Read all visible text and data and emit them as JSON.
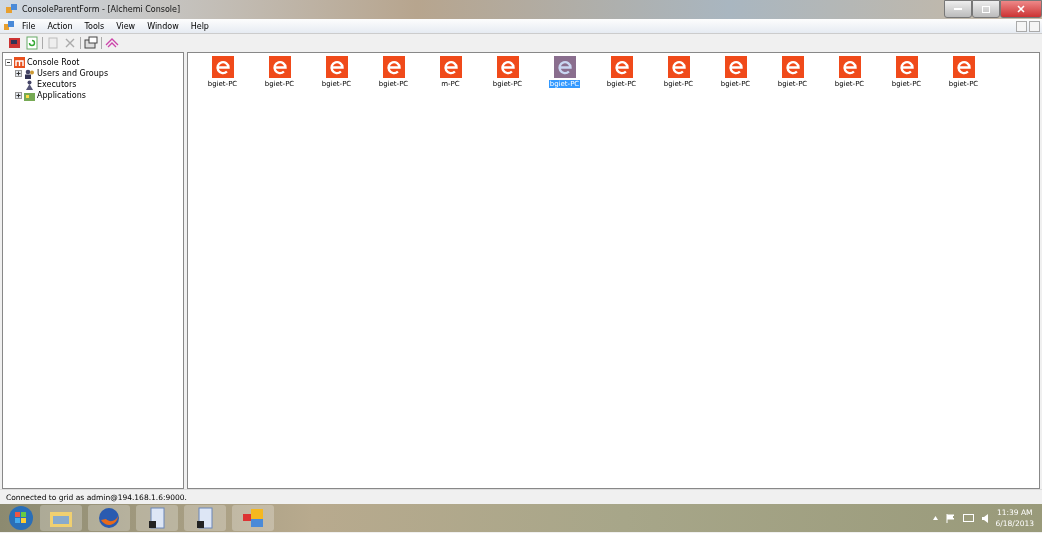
{
  "window": {
    "title": "ConsoleParentForm - [Alchemi Console]"
  },
  "menu": [
    "File",
    "Action",
    "Tools",
    "View",
    "Window",
    "Help"
  ],
  "tree": [
    {
      "label": "Console Root",
      "expanded": true,
      "children": [
        {
          "label": "Users and Groups",
          "expanded": false,
          "kind": "users"
        },
        {
          "label": "Executors",
          "kind": "executors"
        },
        {
          "label": "Applications",
          "expanded": false,
          "kind": "apps"
        }
      ]
    }
  ],
  "executors": [
    {
      "label": "bgiet-PC",
      "selected": false
    },
    {
      "label": "bgiet-PC",
      "selected": false
    },
    {
      "label": "bgiet-PC",
      "selected": false
    },
    {
      "label": "bgiet-PC",
      "selected": false
    },
    {
      "label": "m-PC",
      "selected": false
    },
    {
      "label": "bgiet-PC",
      "selected": false
    },
    {
      "label": "bgiet-PC",
      "selected": true
    },
    {
      "label": "bgiet-PC",
      "selected": false
    },
    {
      "label": "bgiet-PC",
      "selected": false
    },
    {
      "label": "bgiet-PC",
      "selected": false
    },
    {
      "label": "bgiet-PC",
      "selected": false
    },
    {
      "label": "bgiet-PC",
      "selected": false
    },
    {
      "label": "bgiet-PC",
      "selected": false
    },
    {
      "label": "bgiet-PC",
      "selected": false
    }
  ],
  "status_bar": "Connected to grid as admin@194.168.1.6:9000.",
  "taskbar": {
    "time": "11:39 AM",
    "date": "6/18/2013"
  }
}
